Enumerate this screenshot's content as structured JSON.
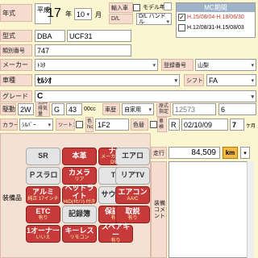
{
  "year": {
    "label": "年式",
    "era": "平成",
    "value": "17",
    "unit_year": "年",
    "month": "10",
    "unit_month": "月",
    "imported_label": "輸入車",
    "model_year_label": "モデル年",
    "model_year_unit": "年",
    "drive_label": "D/L 運転",
    "drive_value": "D/L ハンドル"
  },
  "mc": {
    "title": "MC期間",
    "items": [
      {
        "text": "H.15/08/04-H.18/06/30",
        "checked": true
      },
      {
        "text": "H.12/08/31-H.15/08/03",
        "checked": false
      }
    ]
  },
  "model": {
    "label": "型式",
    "prefix": "DBA",
    "code": "UCF31",
    "class_label": "類別番号",
    "class_value": "747"
  },
  "maker": {
    "label": "メーカー",
    "value": "ﾄﾖﾀ",
    "reg_label": "登録番号",
    "reg_value": "山梨"
  },
  "car": {
    "label": "車種",
    "value": "ｾﾙｼｵ",
    "shift_label": "シフト",
    "shift_value": "FA"
  },
  "grade": {
    "label": "グレード",
    "value": "C"
  },
  "drive": {
    "label": "駆動",
    "value": "2W",
    "fuel": "G",
    "cc": "43",
    "cc_unit": "00cc",
    "disp_label": "燃料 排気量",
    "body_label": "車歴",
    "body_value": "自家用",
    "frame_label": "原式 指定",
    "frame_value": "12573",
    "frame_num": "6"
  },
  "color": {
    "label": "カラー",
    "value": "ｼﾙﾊﾞｰ",
    "tone_label": "ツートン",
    "color_no_label": "色 No",
    "color_no": "1F2",
    "change_label": "色替",
    "car_inspection_label": "車検",
    "inspection_date": "02/10/09",
    "period": "7",
    "period_unit": "ケ月"
  },
  "mileage": {
    "label": "走行",
    "value": "84,509",
    "unit": "km"
  },
  "equipment": {
    "label": "装備品",
    "comment_label": "装備 コメント",
    "items": [
      {
        "title": "SR",
        "sub": "",
        "on": false
      },
      {
        "title": "本革",
        "sub": "",
        "on": true
      },
      {
        "title": "ナビ",
        "sub": "メーカー(OP) DVD",
        "on": true
      },
      {
        "title": "エアロ",
        "sub": "",
        "on": false
      },
      {
        "title": "Ｐスラロ",
        "sub": "",
        "on": false
      },
      {
        "title": "カメラ",
        "sub": "リア",
        "on": true
      },
      {
        "title": "TV",
        "sub": "",
        "on": false
      },
      {
        "title": "リアTV",
        "sub": "",
        "on": false
      },
      {
        "title": "アルミ",
        "sub": "純正 17インチ",
        "on": true
      },
      {
        "title": "ヘッドライト",
        "sub": "HID(ｷｾﾉﾝ) 付き",
        "on": true
      },
      {
        "title": "サウンド",
        "sub": "",
        "on": false
      },
      {
        "title": "エアコン",
        "sub": "AA/C",
        "on": true
      },
      {
        "title": "ETC",
        "sub": "有り",
        "on": true
      },
      {
        "title": "記録簿",
        "sub": "",
        "on": false
      },
      {
        "title": "保証書",
        "sub": "有り",
        "on": true
      },
      {
        "title": "取説",
        "sub": "有り",
        "on": true
      },
      {
        "title": "1オーナー",
        "sub": "いいえ",
        "on": true
      },
      {
        "title": "キーレス",
        "sub": "リモコン",
        "on": true
      },
      {
        "title": "スペアキー",
        "sub": "有り",
        "on": true
      }
    ]
  }
}
